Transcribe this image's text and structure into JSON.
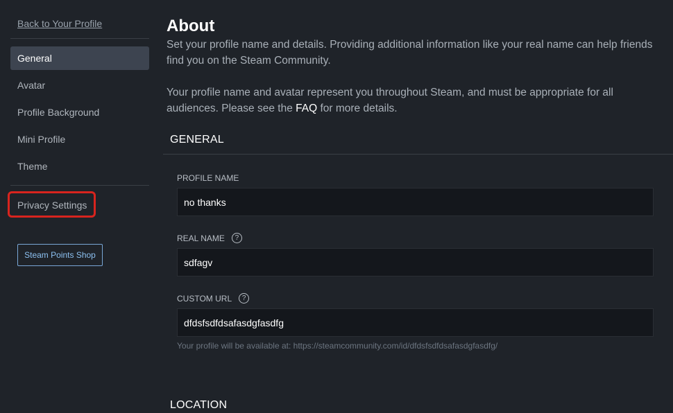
{
  "sidebar": {
    "back_link": "Back to Your Profile",
    "items": [
      {
        "label": "General"
      },
      {
        "label": "Avatar"
      },
      {
        "label": "Profile Background"
      },
      {
        "label": "Mini Profile"
      },
      {
        "label": "Theme"
      },
      {
        "label": "Privacy Settings"
      }
    ],
    "points_shop_button": "Steam Points Shop"
  },
  "main": {
    "title": "About",
    "intro_line1": "Set your profile name and details. Providing additional information like your real name can help friends find you on the Steam Community.",
    "intro_line2_before": "Your profile name and avatar represent you throughout Steam, and must be appropriate for all audiences. Please see the ",
    "intro_line2_link": "FAQ",
    "intro_line2_after": " for more details.",
    "section_general": "GENERAL",
    "fields": {
      "profile_name": {
        "label": "PROFILE NAME",
        "value": "no thanks"
      },
      "real_name": {
        "label": "REAL NAME",
        "value": "sdfagv"
      },
      "custom_url": {
        "label": "CUSTOM URL",
        "value": "dfdsfsdfdsafasdgfasdfg"
      }
    },
    "url_hint": "Your profile will be available at: https://steamcommunity.com/id/dfdsfsdfdsafasdgfasdfg/",
    "section_location": "LOCATION"
  },
  "icons": {
    "help": "help-circle-icon",
    "help_glyph": "?"
  },
  "colors": {
    "background": "#1f2329",
    "active_nav": "#3d4450",
    "input_bg": "#14171c",
    "highlight": "#d8241e",
    "accent_blue": "#8cc0f0"
  }
}
